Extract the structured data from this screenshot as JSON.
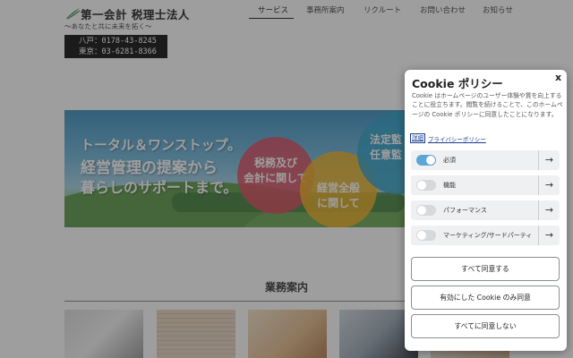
{
  "header": {
    "company_name": "第一会計 税理士法人",
    "tagline": "～あなたと共に未来を拓く～",
    "phones": [
      "八戸：0178-43-8245",
      "東京：03-6281-8366"
    ]
  },
  "nav": {
    "items": [
      "サービス",
      "事務所案内",
      "リクルート",
      "お問い合わせ",
      "お知らせ"
    ],
    "active_index": 0
  },
  "hero": {
    "line1": "トータル＆ワンストップ。",
    "line2": "経営管理の提案から",
    "line3": "暮らしのサポートまで。",
    "bubble_red": [
      "税務及び",
      "会計に関して"
    ],
    "bubble_yellow": [
      "経営全般",
      "に関して"
    ],
    "bubble_blue": [
      "法定監",
      "任意監"
    ]
  },
  "services": {
    "title": "業務案内"
  },
  "cookie": {
    "title": "Cookie ポリシー",
    "close_label": "x",
    "description": "Cookie はホームページのユーザー体験や質を向上することに役立ちます。閲覧を続けることで、このホームページの Cookie ポリシーに同意したことになります。",
    "details_link": "詳細",
    "privacy_link": "プライバシーポリシー",
    "categories": [
      {
        "label": "必須",
        "enabled": true
      },
      {
        "label": "機能",
        "enabled": false
      },
      {
        "label": "パフォーマンス",
        "enabled": false
      },
      {
        "label": "マーケティング/サードパーティ",
        "enabled": false
      }
    ],
    "arrow_glyph": "→",
    "accept_all": "すべて同意する",
    "accept_enabled": "有効にした Cookie のみ同意",
    "reject_all": "すべてに同意しない"
  },
  "colors": {
    "toggle_on": "#5ba5d9",
    "toggle_off": "#d6d9dc",
    "link": "#1a3d8f",
    "phone_box": "#111111"
  }
}
